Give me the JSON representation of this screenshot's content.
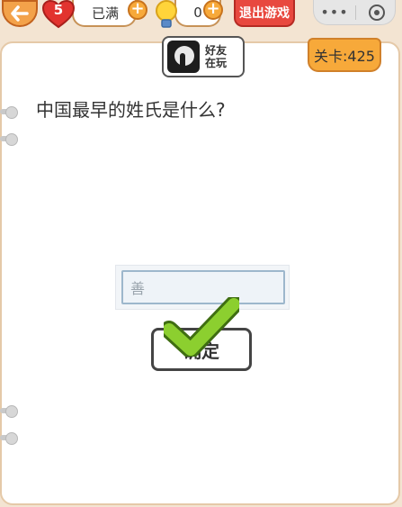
{
  "topbar": {
    "lives_count": "5",
    "lives_status": "已满",
    "hints_count": "0",
    "exit_label": "退出游戏",
    "capsule_more": "•••"
  },
  "friend": {
    "line1": "好友",
    "line2": "在玩"
  },
  "level": {
    "label": "关卡:425"
  },
  "question": {
    "text": "中国最早的姓氏是什么?"
  },
  "answer": {
    "value": "善"
  },
  "confirm": {
    "label": "确定"
  },
  "colors": {
    "background": "#f3e4d2",
    "accent_orange": "#f7a93a",
    "exit_red": "#e8483f",
    "check_green": "#8ccf2f"
  },
  "icons": [
    "back-arrow-icon",
    "heart-icon",
    "plus-icon",
    "lightbulb-icon",
    "more-icon",
    "close-target-icon",
    "checkmark-icon"
  ]
}
